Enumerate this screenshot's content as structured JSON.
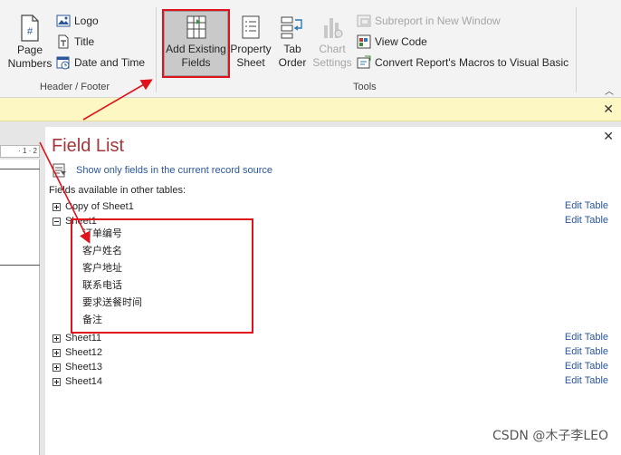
{
  "ribbon": {
    "header_footer": {
      "page_numbers": "Page\nNumbers",
      "page_label": "Page",
      "numbers_label": "Numbers",
      "logo": "Logo",
      "title": "Title",
      "date_time": "Date and Time",
      "group": "Header / Footer"
    },
    "tools": {
      "add_existing_1": "Add Existing",
      "add_existing_2": "Fields",
      "property_1": "Property",
      "property_2": "Sheet",
      "tab_1": "Tab",
      "tab_2": "Order",
      "chart_1": "Chart",
      "chart_2": "Settings",
      "subreport": "Subreport in New Window",
      "view_code": "View Code",
      "convert_macros": "Convert Report's Macros to Visual Basic",
      "group": "Tools"
    }
  },
  "message_bar": {
    "close": "✕"
  },
  "left_pane": {
    "ruler_text": "· 1 · 2"
  },
  "field_list": {
    "title": "Field List",
    "close": "✕",
    "show_only": "Show only fields in the current record source",
    "available_label": "Fields available in other tables:",
    "tables": [
      {
        "name": "Copy of Sheet1",
        "edit": "Edit Table"
      },
      {
        "name": "Sheet1",
        "edit": "Edit Table"
      },
      {
        "name": "Sheet11",
        "edit": "Edit Table"
      },
      {
        "name": "Sheet12",
        "edit": "Edit Table"
      },
      {
        "name": "Sheet13",
        "edit": "Edit Table"
      },
      {
        "name": "Sheet14",
        "edit": "Edit Table"
      }
    ],
    "sheet1_fields": [
      "订单编号",
      "客户姓名",
      "客户地址",
      "联系电话",
      "要求送餐时间",
      "备注"
    ]
  },
  "watermark": "CSDN @木子李LEO",
  "colors": {
    "annotation_red": "#e0121b",
    "title_red": "#a4373a",
    "link_blue": "#2b579a",
    "message_yellow": "#fdf7c3"
  }
}
